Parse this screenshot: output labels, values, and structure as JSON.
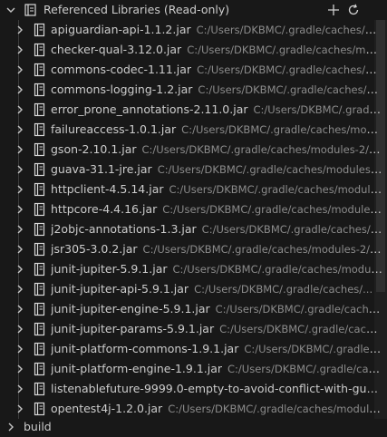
{
  "header": {
    "title": "Referenced Libraries (Read-only)",
    "add_tooltip_icon": "plus-icon",
    "refresh_icon": "refresh-icon"
  },
  "libraries": [
    {
      "name": "apiguardian-api-1.1.2.jar",
      "path": "C:/Users/DKBMC/.gradle/caches/mo..."
    },
    {
      "name": "checker-qual-3.12.0.jar",
      "path": "C:/Users/DKBMC/.gradle/caches/mod..."
    },
    {
      "name": "commons-codec-1.11.jar",
      "path": "C:/Users/DKBMC/.gradle/caches/m..."
    },
    {
      "name": "commons-logging-1.2.jar",
      "path": "C:/Users/DKBMC/.gradle/caches/m..."
    },
    {
      "name": "error_prone_annotations-2.11.0.jar",
      "path": "C:/Users/DKBMC/.gradle/..."
    },
    {
      "name": "failureaccess-1.0.1.jar",
      "path": "C:/Users/DKBMC/.gradle/caches/modul..."
    },
    {
      "name": "gson-2.10.1.jar",
      "path": "C:/Users/DKBMC/.gradle/caches/modules-2/fil..."
    },
    {
      "name": "guava-31.1-jre.jar",
      "path": "C:/Users/DKBMC/.gradle/caches/modules-2..."
    },
    {
      "name": "httpclient-4.5.14.jar",
      "path": "C:/Users/DKBMC/.gradle/caches/modules..."
    },
    {
      "name": "httpcore-4.4.16.jar",
      "path": "C:/Users/DKBMC/.gradle/caches/modules-..."
    },
    {
      "name": "j2objc-annotations-1.3.jar",
      "path": "C:/Users/DKBMC/.gradle/caches/m..."
    },
    {
      "name": "jsr305-3.0.2.jar",
      "path": "C:/Users/DKBMC/.gradle/caches/modules-2/fil..."
    },
    {
      "name": "junit-jupiter-5.9.1.jar",
      "path": "C:/Users/DKBMC/.gradle/caches/module..."
    },
    {
      "name": "junit-jupiter-api-5.9.1.jar",
      "path": "C:/Users/DKBMC/.gradle/caches/..."
    },
    {
      "name": "junit-jupiter-engine-5.9.1.jar",
      "path": "C:/Users/DKBMC/.gradle/cache..."
    },
    {
      "name": "junit-jupiter-params-5.9.1.jar",
      "path": "C:/Users/DKBMC/.gradle/cache..."
    },
    {
      "name": "junit-platform-commons-1.9.1.jar",
      "path": "C:/Users/DKBMC/.gradle/c..."
    },
    {
      "name": "junit-platform-engine-1.9.1.jar",
      "path": "C:/Users/DKBMC/.gradle/cach..."
    },
    {
      "name": "listenablefuture-9999.0-empty-to-avoid-conflict-with-gua...",
      "path": ""
    },
    {
      "name": "opentest4j-1.2.0.jar",
      "path": "C:/Users/DKBMC/.gradle/caches/modules..."
    }
  ],
  "footer_node": {
    "label": "build"
  },
  "colors": {
    "background": "#181818",
    "text": "#cccccc",
    "path_text": "#8b8b8b",
    "icon": "#d8d8d8"
  }
}
